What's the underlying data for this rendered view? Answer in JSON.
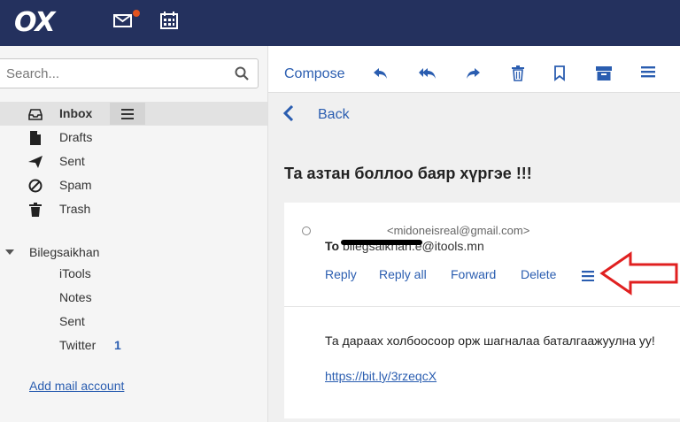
{
  "brand": {
    "logo": "OX"
  },
  "search": {
    "placeholder": "Search..."
  },
  "folders": [
    {
      "label": "Inbox",
      "icon": "inbox-icon"
    },
    {
      "label": "Drafts",
      "icon": "file-icon"
    },
    {
      "label": "Sent",
      "icon": "paper-plane-icon"
    },
    {
      "label": "Spam",
      "icon": "ban-icon"
    },
    {
      "label": "Trash",
      "icon": "trash-icon"
    }
  ],
  "account": {
    "name": "Bilegsaikhan",
    "folders": [
      {
        "label": "iTools"
      },
      {
        "label": "Notes"
      },
      {
        "label": "Sent"
      },
      {
        "label": "Twitter",
        "count": "1"
      }
    ]
  },
  "add_account_label": "Add mail account",
  "toolbar": {
    "compose_label": "Compose"
  },
  "detail": {
    "back_label": "Back",
    "subject": "Та азтан боллоо баяр хүргэе !!!",
    "from": "<midoneisreal@gmail.com>",
    "to_label": "To",
    "to_address": "bilegsaikhan.e@itools.mn",
    "actions": [
      "Reply",
      "Reply all",
      "Forward",
      "Delete"
    ],
    "body": "Та дараах холбоосоор орж шагналаа баталгаажуулна уу!",
    "link": "https://bit.ly/3rzeqcX"
  },
  "colors": {
    "topbar": "#24315e",
    "accent": "#2a5db0",
    "annotation_arrow": "#e02020",
    "notification_dot": "#e2531e"
  }
}
